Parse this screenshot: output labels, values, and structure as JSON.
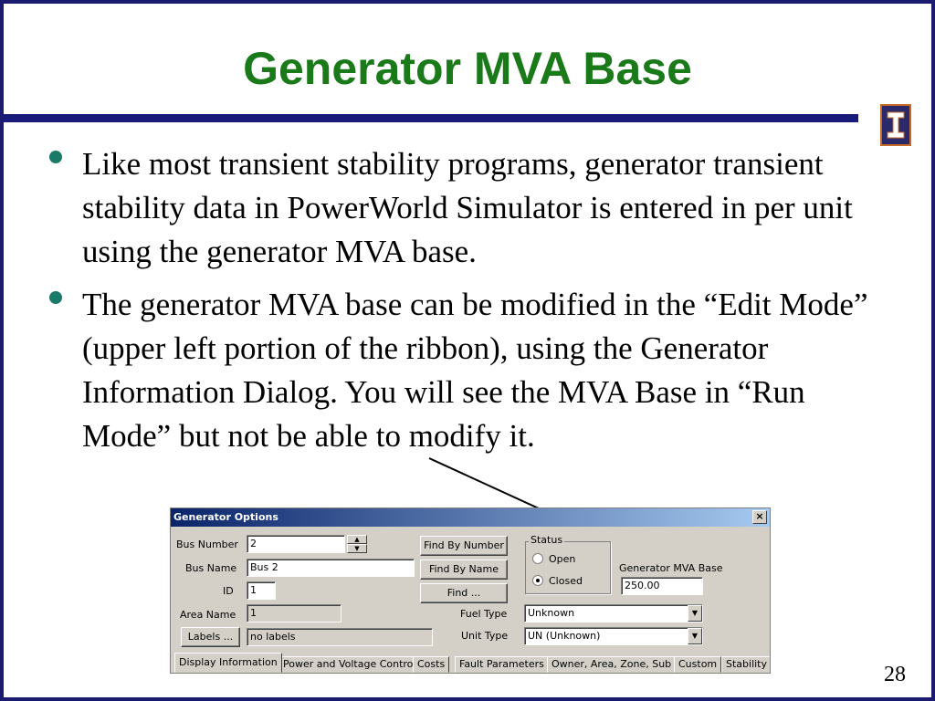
{
  "slide": {
    "title": "Generator MVA Base",
    "bullets": [
      "Like most transient stability programs, generator transient stability data in PowerWorld Simulator is entered in per unit using the generator MVA base.",
      "The generator MVA base can be modified in the “Edit Mode” (upper left portion of the ribbon), using the Generator Information Dialog.  You will see the MVA Base in “Run Mode” but not be able to modify it."
    ],
    "page_number": "28",
    "logo_icon": "illinois-block-i-icon"
  },
  "dialog": {
    "title": "Generator Options",
    "close_label": "×",
    "bus_number_label": "Bus Number",
    "bus_number_value": "2",
    "bus_name_label": "Bus Name",
    "bus_name_value": "Bus 2",
    "id_label": "ID",
    "id_value": "1",
    "area_name_label": "Area Name",
    "area_name_value": "1",
    "labels_button": "Labels ...",
    "labels_value": "no labels",
    "find_by_number": "Find By Number",
    "find_by_name": "Find By Name",
    "find": "Find ...",
    "fuel_type_label": "Fuel Type",
    "fuel_type_value": "Unknown",
    "unit_type_label": "Unit Type",
    "unit_type_value": "UN (Unknown)",
    "status_label": "Status",
    "status_open": "Open",
    "status_closed": "Closed",
    "status_selected": "Closed",
    "mva_base_label": "Generator MVA Base",
    "mva_base_value": "250.00",
    "tabs": [
      "Display Information",
      "Power and Voltage Control",
      "Costs",
      "Fault Parameters",
      "Owner, Area, Zone, Sub",
      "Custom",
      "Stability"
    ],
    "active_tab": "Display Information"
  },
  "colors": {
    "title": "#1a7a1a",
    "rule": "#1a1a7a",
    "bullet": "#1a7a6a",
    "dialog_face": "#d4d0c8",
    "titlebar_start": "#0a246a",
    "titlebar_end": "#a6caf0"
  }
}
